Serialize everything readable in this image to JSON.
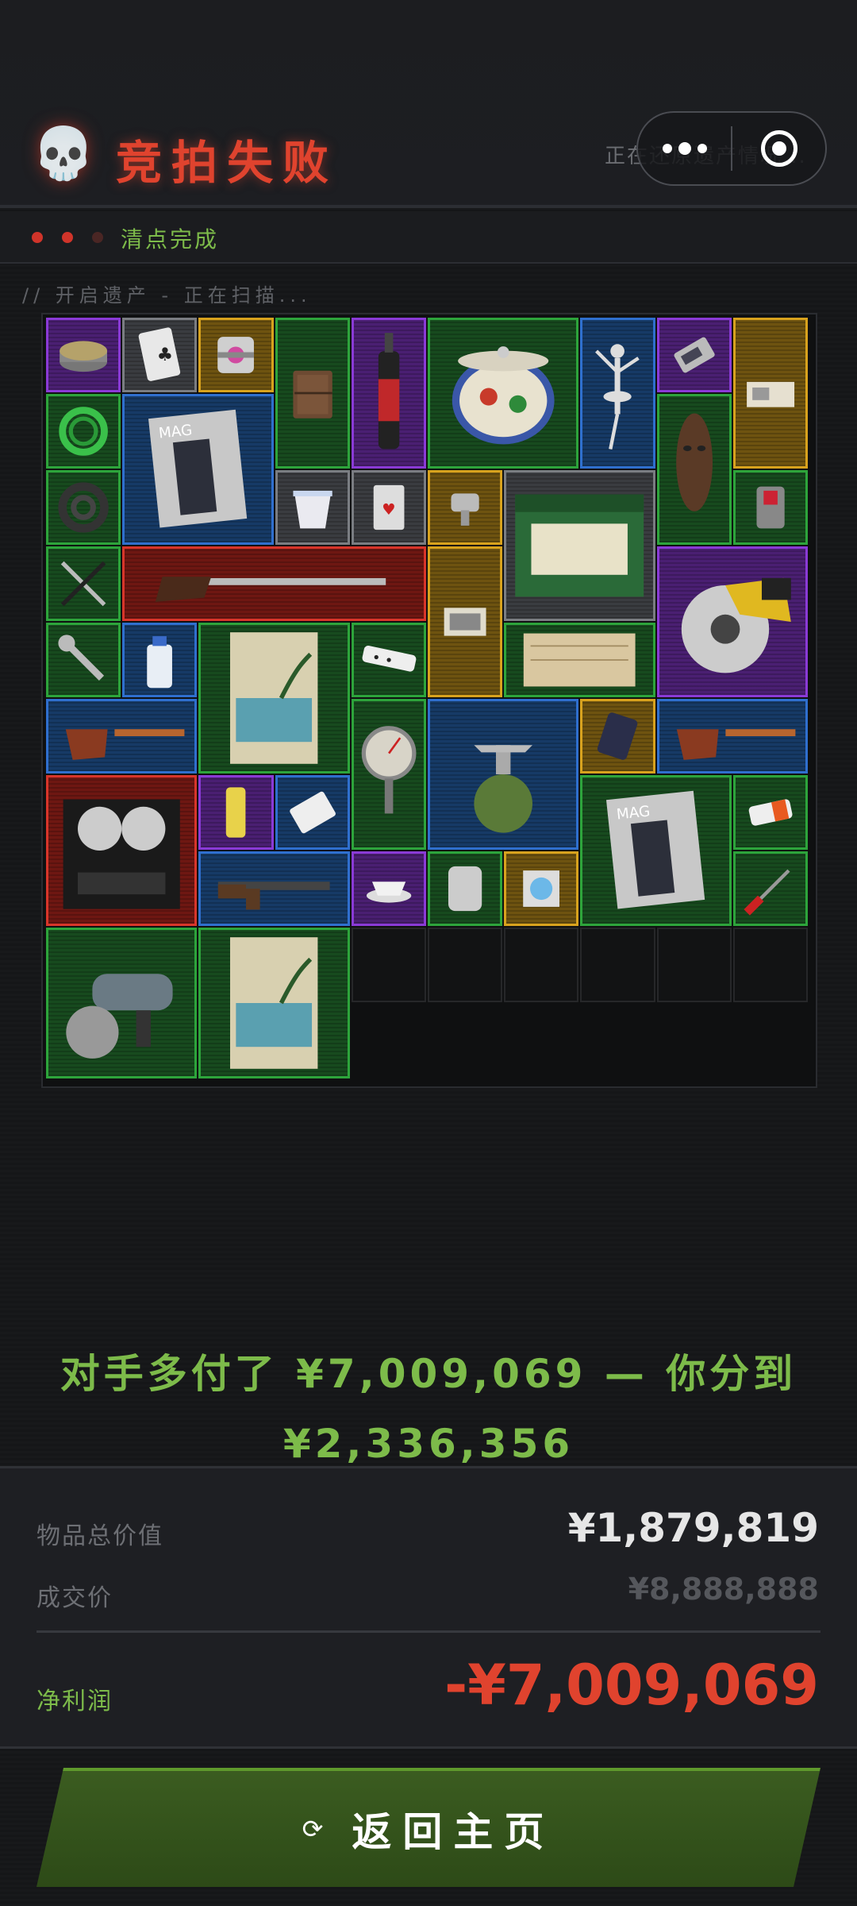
{
  "header": {
    "title": "竞拍失败",
    "subtext": "正在还原遗产情况...",
    "skull_icon": "skull-icon",
    "accent_color": "#e0432e"
  },
  "progress": {
    "status": "清点完成",
    "dots": [
      "#d0342a",
      "#d0342a",
      "#4a2624"
    ]
  },
  "scan_text": "// 开启遗产 - 正在扫描...",
  "grid_items": [
    {
      "name": "canned-food-icon",
      "rarity": "purple"
    },
    {
      "name": "playing-card-icon",
      "rarity": "gray"
    },
    {
      "name": "cube-gadget-icon",
      "rarity": "gold"
    },
    {
      "name": "leather-journal-icon",
      "rarity": "green"
    },
    {
      "name": "spray-torch-icon",
      "rarity": "purple"
    },
    {
      "name": "porcelain-pot-icon",
      "rarity": "green"
    },
    {
      "name": "ballerina-statue-icon",
      "rarity": "blue"
    },
    {
      "name": "usb-drive-icon",
      "rarity": "purple"
    },
    {
      "name": "ticket-icon",
      "rarity": "gold"
    },
    {
      "name": "green-cable-icon",
      "rarity": "green"
    },
    {
      "name": "magazine-icon",
      "rarity": "blue"
    },
    {
      "name": "tribal-mask-icon",
      "rarity": "green"
    },
    {
      "name": "hose-coil-icon",
      "rarity": "green"
    },
    {
      "name": "yogurt-cup-icon",
      "rarity": "gray"
    },
    {
      "name": "card-icon",
      "rarity": "gray"
    },
    {
      "name": "faucet-icon",
      "rarity": "gold"
    },
    {
      "name": "candle-box-icon",
      "rarity": "gray"
    },
    {
      "name": "lighter-icon",
      "rarity": "green"
    },
    {
      "name": "pliers-icon",
      "rarity": "green"
    },
    {
      "name": "musket-icon",
      "rarity": "red"
    },
    {
      "name": "photo-icon",
      "rarity": "gold"
    },
    {
      "name": "circular-saw-icon",
      "rarity": "purple"
    },
    {
      "name": "wrench-icon",
      "rarity": "green"
    },
    {
      "name": "water-bottle-icon",
      "rarity": "blue"
    },
    {
      "name": "beach-poster-icon",
      "rarity": "green"
    },
    {
      "name": "power-strip-icon",
      "rarity": "green"
    },
    {
      "name": "old-document-icon",
      "rarity": "green"
    },
    {
      "name": "smoking-pipe-icon",
      "rarity": "blue"
    },
    {
      "name": "pressure-gauge-icon",
      "rarity": "green"
    },
    {
      "name": "camping-stove-icon",
      "rarity": "blue"
    },
    {
      "name": "smartphone-icon",
      "rarity": "gold"
    },
    {
      "name": "smoking-pipe-icon",
      "rarity": "blue"
    },
    {
      "name": "reel-recorder-icon",
      "rarity": "red"
    },
    {
      "name": "energy-can-icon",
      "rarity": "purple"
    },
    {
      "name": "pill-pack-icon",
      "rarity": "blue"
    },
    {
      "name": "magazine-icon",
      "rarity": "green"
    },
    {
      "name": "battery-icon",
      "rarity": "green"
    },
    {
      "name": "rifle-icon",
      "rarity": "blue"
    },
    {
      "name": "teacup-icon",
      "rarity": "purple"
    },
    {
      "name": "iv-bag-icon",
      "rarity": "green"
    },
    {
      "name": "disc-case-icon",
      "rarity": "gold"
    },
    {
      "name": "screwdriver-icon",
      "rarity": "green"
    },
    {
      "name": "angle-grinder-icon",
      "rarity": "green"
    },
    {
      "name": "beach-poster-icon",
      "rarity": "green"
    }
  ],
  "message": {
    "line1": "对手多付了 ¥7,009,069 — 你分到",
    "line2": "¥2,336,356"
  },
  "summary": {
    "total_value_label": "物品总价值",
    "total_value": "¥1,879,819",
    "deal_price_label": "成交价",
    "deal_price": "¥8,888,888",
    "net_profit_label": "净利润",
    "net_profit": "-¥7,009,069",
    "loss_color": "#e0432e",
    "profit_label_color": "#7dbb4a"
  },
  "button": {
    "label": "返回主页",
    "icon": "refresh-icon"
  }
}
